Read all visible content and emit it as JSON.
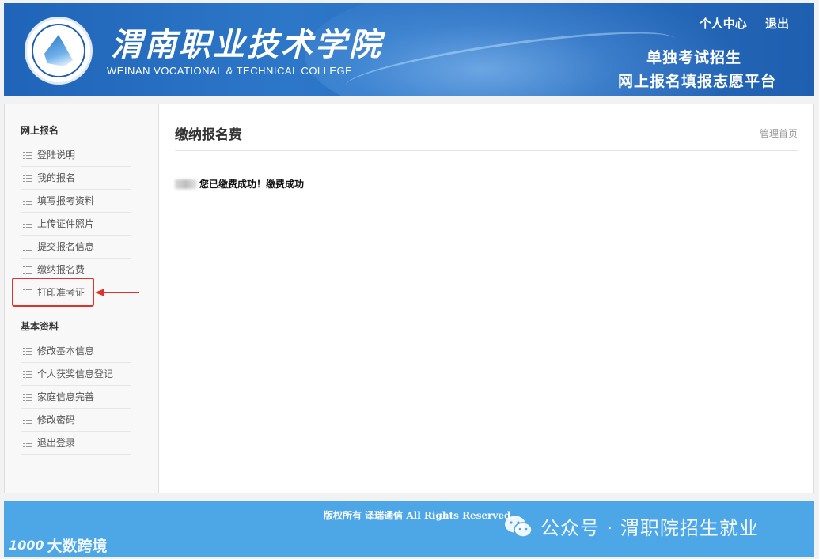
{
  "header": {
    "college_name_cn": "渭南职业技术学院",
    "college_name_en": "WEINAN VOCATIONAL & TECHNICAL COLLEGE",
    "logo_text": "渭南职业技术学院",
    "top_links": [
      "个人中心",
      "退出"
    ],
    "platform_line1": "单独考试招生",
    "platform_line2": "网上报名填报志愿平台"
  },
  "sidebar": {
    "groups": [
      {
        "title": "网上报名",
        "items": [
          "登陆说明",
          "我的报名",
          "填写报考资料",
          "上传证件照片",
          "提交报名信息",
          "缴纳报名费",
          "打印准考证"
        ]
      },
      {
        "title": "基本资料",
        "items": [
          "修改基本信息",
          "个人获奖信息登记",
          "家庭信息完善",
          "修改密码",
          "退出登录"
        ]
      }
    ],
    "highlighted_item": "打印准考证"
  },
  "main": {
    "page_title": "缴纳报名费",
    "home_link": "管理首页",
    "message": "您已缴费成功！缴费成功"
  },
  "footer": {
    "copyright": "版权所有 泽瑞通信 All Rights Reserved."
  },
  "watermarks": {
    "left": "大数跨境",
    "left_logo": "1000",
    "right": "公众号 · 渭职院招生就业"
  },
  "colors": {
    "header_blue": "#2d77c8",
    "footer_blue": "#4da6e6",
    "highlight_red": "#e0322c"
  }
}
